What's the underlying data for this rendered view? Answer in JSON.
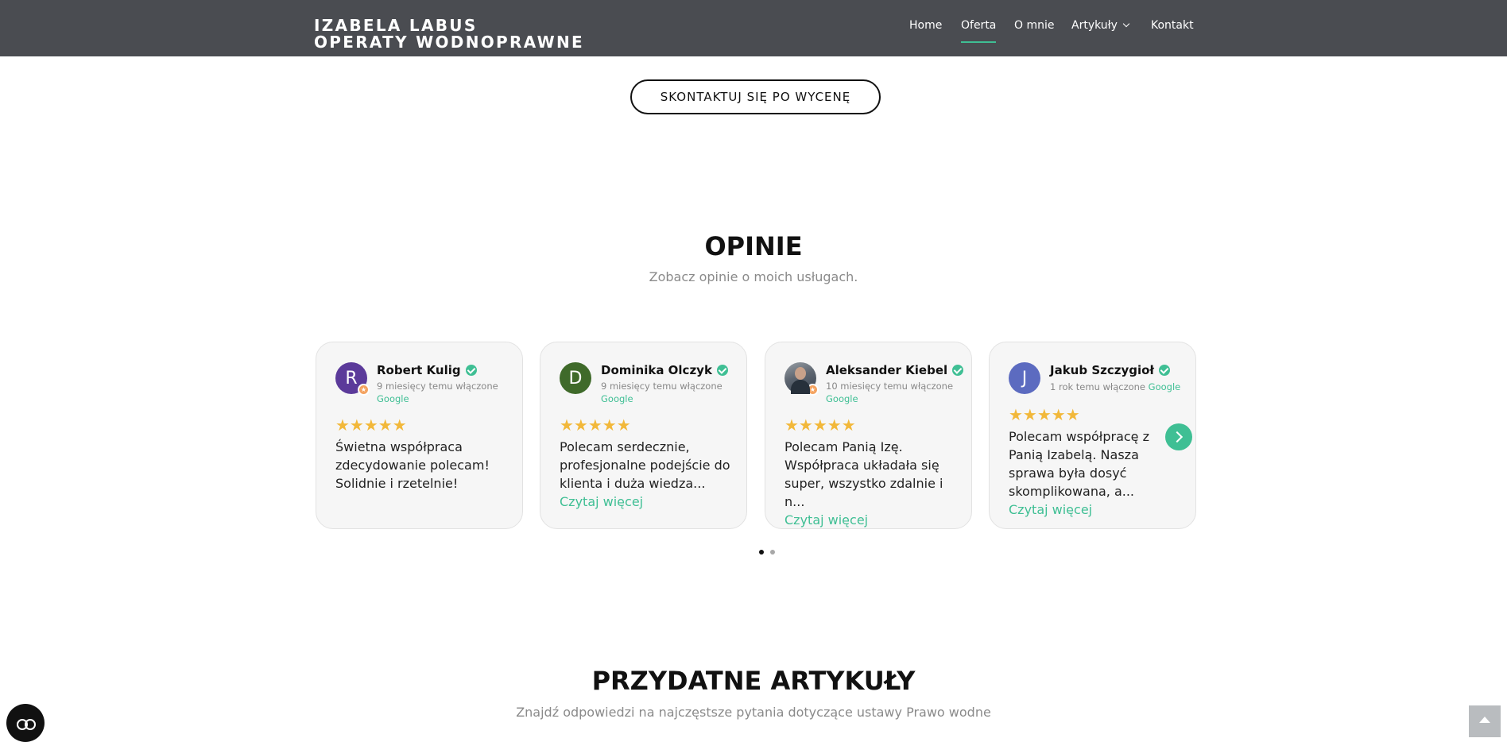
{
  "header": {
    "brand_line1": "IZABELA LABUS",
    "brand_line2": "OPERATY WODNOPRAWNE",
    "nav": [
      {
        "label": "Home"
      },
      {
        "label": "Oferta",
        "active": true
      },
      {
        "label": "O mnie"
      },
      {
        "label": "Artykuły",
        "has_dropdown": true
      },
      {
        "label": "Kontakt"
      }
    ]
  },
  "cta": {
    "label": "SKONTAKTUJ SIĘ PO WYCENĘ"
  },
  "reviews_section": {
    "title": "OPINIE",
    "subtitle": "Zobacz opinie o moich usługach.",
    "reviews": [
      {
        "initial": "R",
        "avatar_color": "#5b3a9a",
        "name": "Robert Kulig",
        "time": "9 miesięcy temu włączone",
        "source": "Google",
        "stars": "★★★★★",
        "text": "Świetna współpraca zdecydowanie polecam! Solidnie i rzetelnie!",
        "more": ""
      },
      {
        "initial": "D",
        "avatar_color": "#3f6a2a",
        "name": "Dominika Olczyk",
        "time": "9 miesięcy temu włączone",
        "source": "Google",
        "stars": "★★★★★",
        "text": "Polecam serdecznie, profesjonalne podejście do klienta i duża wiedza...",
        "more": "Czytaj więcej"
      },
      {
        "initial": "",
        "avatar_color": "#5d6570",
        "name": "Aleksander Kiebel",
        "time": "10 miesięcy temu włączone",
        "source": "Google",
        "stars": "★★★★★",
        "text": "Polecam Panią Izę. Współpraca układała się super, wszystko zdalnie i n...",
        "more": "Czytaj więcej"
      },
      {
        "initial": "J",
        "avatar_color": "#5c6bc0",
        "name": "Jakub Szczygioł",
        "time": "1 rok temu włączone",
        "source": "Google",
        "stars": "★★★★★",
        "text": "Polecam współpracę z Panią Izabelą. Nasza sprawa była dosyć skomplikowana, a...",
        "more": "Czytaj więcej"
      }
    ],
    "pagination": {
      "pages": 2,
      "current": 1
    }
  },
  "articles_section": {
    "title": "PRZYDATNE ARTYKUŁY",
    "subtitle": "Znajdź odpowiedzi na najczęstsze pytania dotyczące ustawy Prawo wodne"
  },
  "colors": {
    "header_bg": "#4a4c51",
    "accent": "#3fbf94",
    "star": "#f2b83a",
    "card_bg": "#f6f6f6"
  },
  "icons": [
    "verified-check-icon",
    "chevron-down-icon",
    "chevron-right-icon",
    "accessibility-icon",
    "back-to-top-icon",
    "star-icon"
  ]
}
